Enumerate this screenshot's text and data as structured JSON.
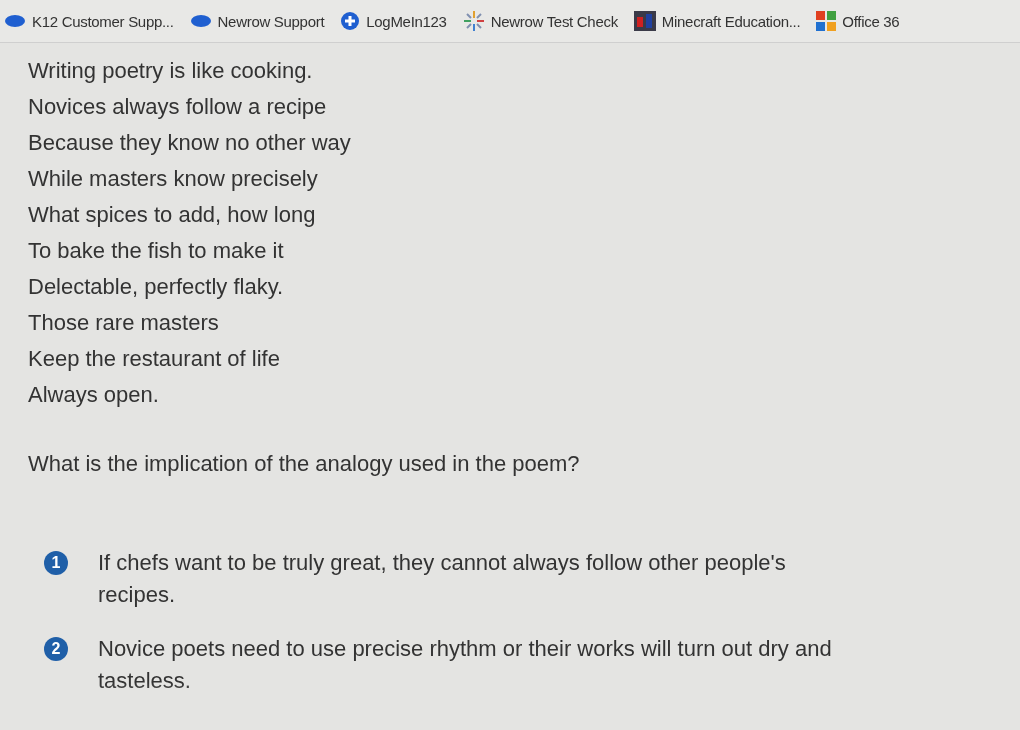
{
  "bookmarks": [
    {
      "kind": "cloud",
      "label": "K12 Customer Supp..."
    },
    {
      "kind": "cloud",
      "label": "Newrow Support"
    },
    {
      "kind": "plus",
      "label": "LogMeIn123"
    },
    {
      "kind": "sparkle",
      "label": "Newrow Test Check"
    },
    {
      "kind": "tile",
      "label": "Minecraft Education..."
    },
    {
      "kind": "grid",
      "label": "Office 36"
    }
  ],
  "poem": [
    "Writing poetry is like cooking.",
    "Novices always follow a recipe",
    "Because they know no other way",
    "While masters know precisely",
    "What spices to add, how long",
    "To bake the fish to make it",
    "Delectable, perfectly flaky.",
    "Those rare masters",
    "Keep the restaurant of life",
    "Always open."
  ],
  "question": "What is the implication of the analogy used in the poem?",
  "options": [
    {
      "number": "1",
      "text": "If chefs want to be truly great, they cannot always follow other people's recipes."
    },
    {
      "number": "2",
      "text": "Novice poets need to use precise rhythm or their works will turn out dry and tasteless."
    }
  ]
}
